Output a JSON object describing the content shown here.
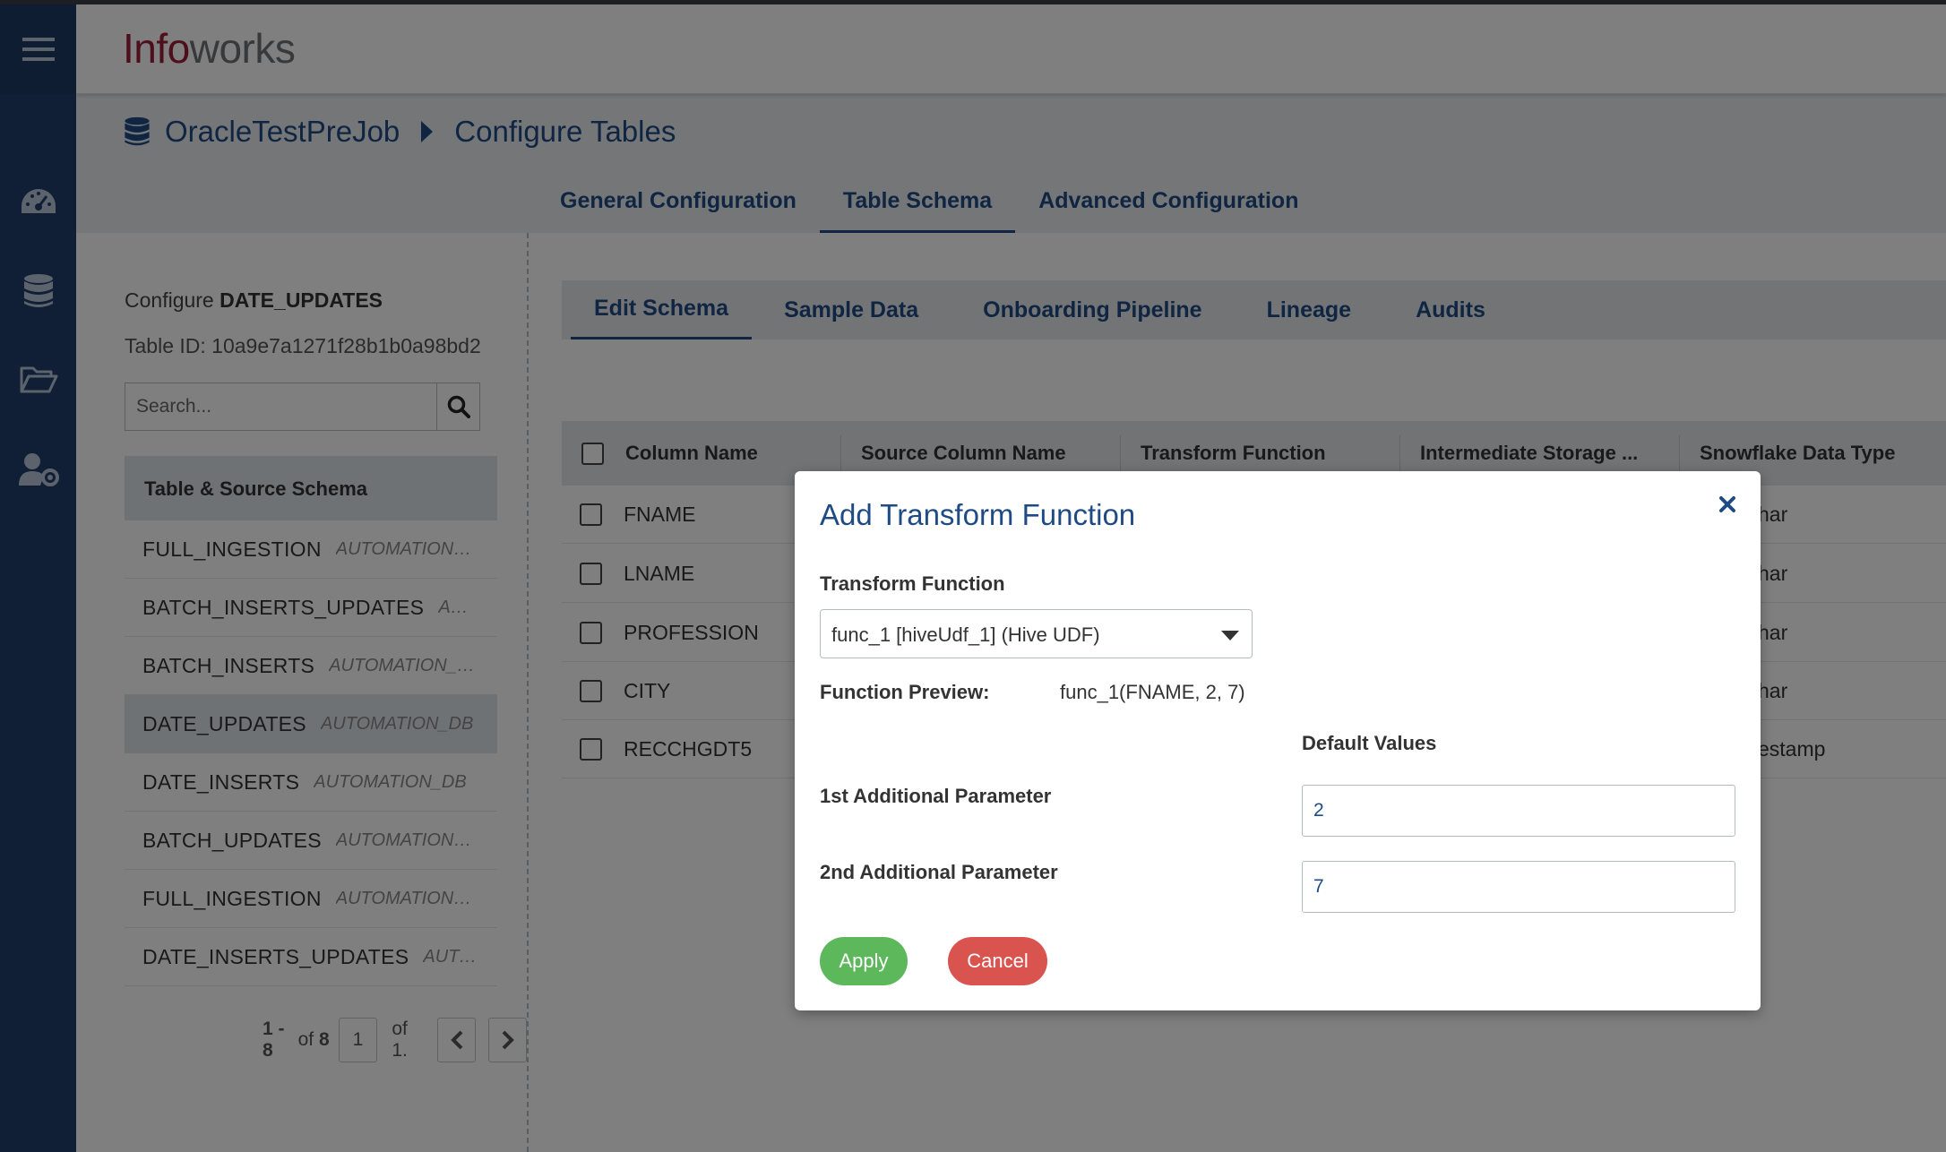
{
  "app": {
    "logo_part1": "Info",
    "logo_part2": "works"
  },
  "rail": {
    "items": [
      {
        "icon": "menu-icon"
      },
      {
        "icon": "dashboard-icon"
      },
      {
        "icon": "database-icon"
      },
      {
        "icon": "folder-open-icon"
      },
      {
        "icon": "user-settings-icon"
      }
    ]
  },
  "breadcrumb": {
    "icon": "database-icon",
    "parent": "OracleTestPreJob",
    "current": "Configure Tables"
  },
  "top_tabs": [
    {
      "label": "General Configuration",
      "active": false
    },
    {
      "label": "Table Schema",
      "active": true
    },
    {
      "label": "Advanced Configuration",
      "active": false
    }
  ],
  "left_panel": {
    "configure_prefix": "Configure ",
    "configure_table": "DATE_UPDATES",
    "table_id": "Table ID: 10a9e7a1271f28b1b0a98bd2",
    "search_placeholder": "Search...",
    "list_header": "Table & Source Schema",
    "items": [
      {
        "name": "FULL_INGESTION",
        "schema": "AUTOMATION_DB",
        "selected": false
      },
      {
        "name": "BATCH_INSERTS_UPDATES",
        "schema": "AUTOMATION_DB",
        "selected": false
      },
      {
        "name": "BATCH_INSERTS",
        "schema": "AUTOMATION_DB",
        "selected": false
      },
      {
        "name": "DATE_UPDATES",
        "schema": "AUTOMATION_DB",
        "selected": true
      },
      {
        "name": "DATE_INSERTS",
        "schema": "AUTOMATION_DB",
        "selected": false
      },
      {
        "name": "BATCH_UPDATES",
        "schema": "AUTOMATION_DB",
        "selected": false
      },
      {
        "name": "FULL_INGESTION",
        "schema": "AUTOMATION_DB",
        "selected": false
      },
      {
        "name": "DATE_INSERTS_UPDATES",
        "schema": "AUTOMATION_DB",
        "selected": false
      }
    ],
    "pager": {
      "range": "1 - 8",
      "of_label": "of",
      "total": "8",
      "page": "1",
      "of_pages": "of 1."
    }
  },
  "sub_tabs": [
    {
      "label": "Edit Schema",
      "active": true
    },
    {
      "label": "Sample Data",
      "active": false
    },
    {
      "label": "Onboarding Pipeline",
      "active": false
    },
    {
      "label": "Lineage",
      "active": false
    },
    {
      "label": "Audits",
      "active": false
    }
  ],
  "table": {
    "columns": [
      "Column Name",
      "Source Column Name",
      "Transform Function",
      "Intermediate Storage ...",
      "Snowflake Data Type"
    ],
    "rows": [
      {
        "name": "FNAME",
        "type_visible": "har"
      },
      {
        "name": "LNAME",
        "type_visible": "har"
      },
      {
        "name": "PROFESSION",
        "type_visible": "har"
      },
      {
        "name": "CITY",
        "type_visible": "har"
      },
      {
        "name": "RECCHGDT5",
        "type_visible": "estamp"
      }
    ]
  },
  "modal": {
    "title": "Add Transform Function",
    "transform_label": "Transform Function",
    "selected_function": "func_1 [hiveUdf_1] (Hive UDF)",
    "preview_label": "Function Preview:",
    "preview_value": "func_1(FNAME, 2, 7)",
    "default_values_label": "Default Values",
    "param1_label": "1st Additional Parameter",
    "param1_value": "2",
    "param2_label": "2nd Additional Parameter",
    "param2_value": "7",
    "apply_label": "Apply",
    "cancel_label": "Cancel"
  },
  "colors": {
    "primary": "#1f4b85",
    "rail": "#203f6b",
    "apply": "#5db85c",
    "cancel": "#d9534f",
    "logo_red": "#9c1e3a"
  }
}
